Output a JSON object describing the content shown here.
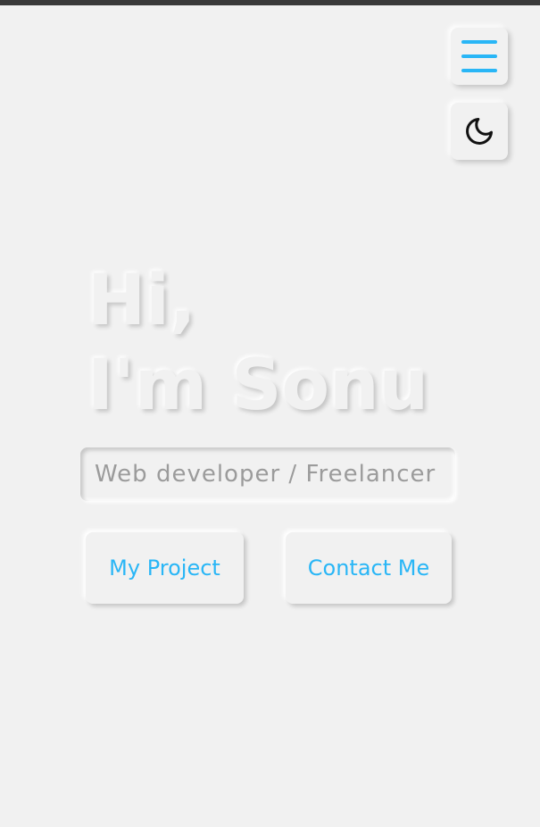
{
  "colors": {
    "background": "#f1f1f1",
    "accent": "#29b6f6",
    "muted_text": "#9b9b9b",
    "top_bar": "#3a3a3a"
  },
  "header": {
    "menu_icon": "hamburger-menu-icon",
    "theme_icon": "moon-icon"
  },
  "hero": {
    "line1": "Hi,",
    "line2": "I'm Sonu",
    "role": "Web developer / Freelancer"
  },
  "actions": {
    "project_label": "My Project",
    "contact_label": "Contact Me"
  }
}
